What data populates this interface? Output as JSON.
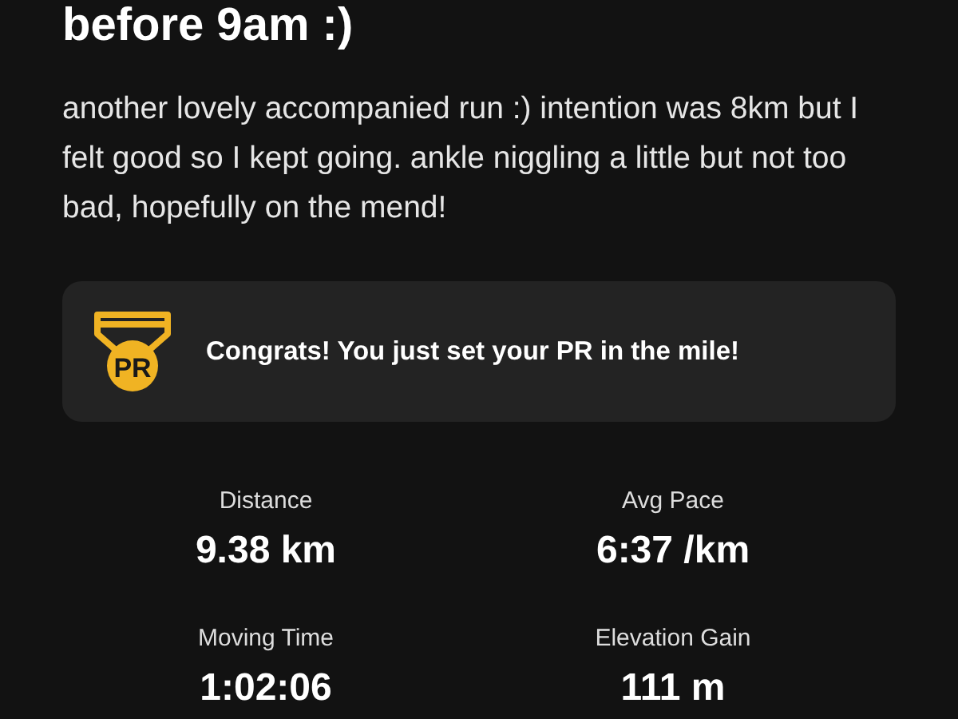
{
  "activity": {
    "title": "before 9am :)",
    "description": "another lovely accompanied run :) intention was 8km but I felt good so I kept going. ankle niggling a little but not too bad, hopefully on the mend!"
  },
  "achievement": {
    "badge": "PR",
    "message": "Congrats! You just set your PR in the mile!"
  },
  "stats": [
    {
      "label": "Distance",
      "value": "9.38 km"
    },
    {
      "label": "Avg Pace",
      "value": "6:37 /km"
    },
    {
      "label": "Moving Time",
      "value": "1:02:06"
    },
    {
      "label": "Elevation Gain",
      "value": "111 m"
    }
  ]
}
